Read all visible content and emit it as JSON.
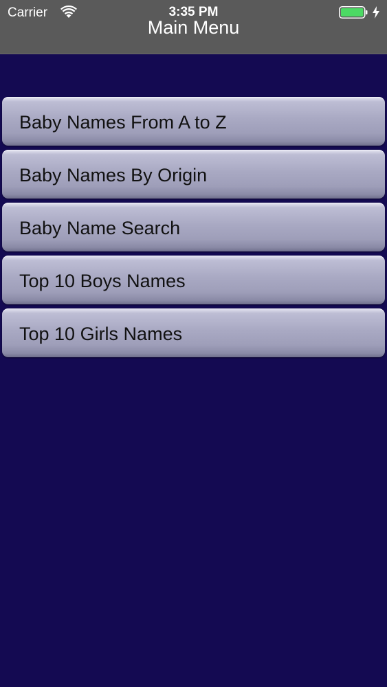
{
  "status_bar": {
    "carrier": "Carrier",
    "time": "3:35 PM",
    "battery_color": "#4cd964"
  },
  "nav": {
    "title": "Main Menu",
    "bar_color": "#5a5a5a"
  },
  "background_color": "#140a52",
  "menu": {
    "items": [
      {
        "label": "Baby Names From A to Z"
      },
      {
        "label": "Baby Names By Origin"
      },
      {
        "label": "Baby Name Search"
      },
      {
        "label": "Top 10 Boys Names"
      },
      {
        "label": "Top 10 Girls Names"
      }
    ]
  }
}
